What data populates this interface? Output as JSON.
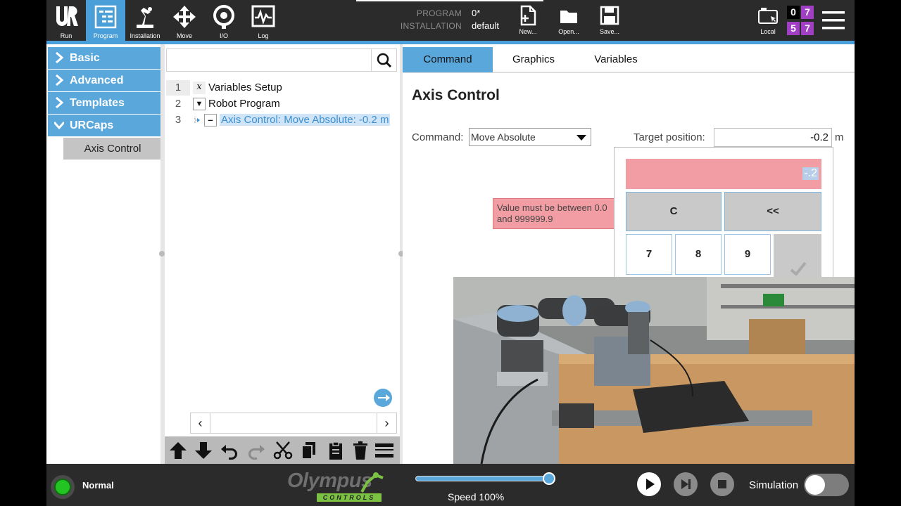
{
  "header": {
    "nav": [
      {
        "label": "Run",
        "icon": "ur-logo-icon"
      },
      {
        "label": "Program",
        "icon": "program-icon"
      },
      {
        "label": "Installation",
        "icon": "installation-icon"
      },
      {
        "label": "Move",
        "icon": "move-icon"
      },
      {
        "label": "I/O",
        "icon": "io-icon"
      },
      {
        "label": "Log",
        "icon": "log-icon"
      }
    ],
    "program_key": "PROGRAM",
    "program_value": "0*",
    "installation_key": "INSTALLATION",
    "installation_value": "default",
    "file": [
      {
        "label": "New...",
        "icon": "new-file-icon"
      },
      {
        "label": "Open...",
        "icon": "open-folder-icon"
      },
      {
        "label": "Save...",
        "icon": "save-icon"
      }
    ],
    "local_label": "Local",
    "counters": [
      "0",
      "7",
      "5",
      "7"
    ],
    "accent_color": "#4a9fd8",
    "counter_color": "#a03fc4"
  },
  "categories": {
    "items": [
      {
        "label": "Basic",
        "expanded": false
      },
      {
        "label": "Advanced",
        "expanded": false
      },
      {
        "label": "Templates",
        "expanded": false
      },
      {
        "label": "URCaps",
        "expanded": true
      }
    ],
    "sub_item": "Axis Control"
  },
  "tree": {
    "search_placeholder": "",
    "rows": [
      {
        "num": "1",
        "glyph": "x",
        "text": "Variables Setup"
      },
      {
        "num": "2",
        "glyph": "▼",
        "text": "Robot Program"
      },
      {
        "num": "3",
        "glyph": "–",
        "text": "Axis Control: Move Absolute: -0.2 m"
      }
    ],
    "toolbar_icons": [
      "move-up-icon",
      "move-down-icon",
      "undo-icon",
      "redo-icon",
      "cut-icon",
      "copy-icon",
      "paste-icon",
      "delete-icon",
      "suppress-icon"
    ]
  },
  "editor": {
    "tabs": [
      "Command",
      "Graphics",
      "Variables"
    ],
    "active_tab": "Command",
    "title": "Axis Control",
    "command_label": "Command:",
    "command_value": "Move Absolute",
    "target_label": "Target position:",
    "target_value": "-0.2",
    "target_unit": "m",
    "keypad_display": "-.2",
    "keys": {
      "clear": "C",
      "backspace": "<<",
      "digits": [
        "7",
        "8",
        "9"
      ]
    },
    "error": "Value must be between 0.0 and 999999.9",
    "error_color": "#f29da3"
  },
  "footer": {
    "status": "Normal",
    "status_color": "#22c322",
    "logo_main": "Olympus",
    "logo_sub": "CONTROLS",
    "speed_label": "Speed 100%",
    "speed_fraction": 1.0,
    "simulation_label": "Simulation",
    "simulation_on": false
  }
}
